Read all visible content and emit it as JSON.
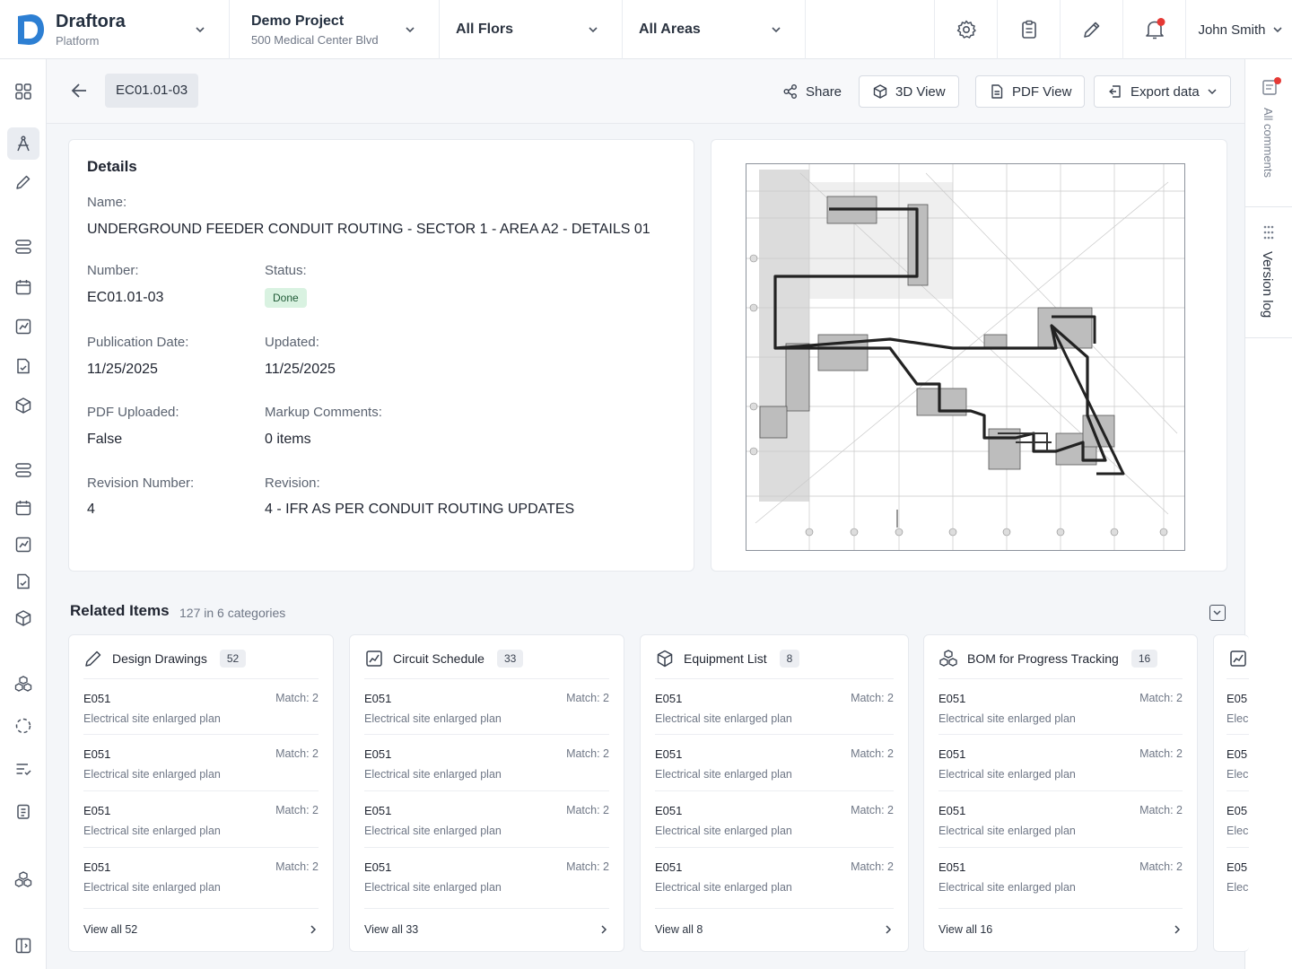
{
  "brand": {
    "name": "Draftora",
    "sub": "Platform"
  },
  "project": {
    "name": "Demo Project",
    "address": "500 Medical Center Blvd"
  },
  "filters": {
    "floors": "All Flors",
    "areas": "All Areas"
  },
  "user": {
    "name": "John Smith"
  },
  "header": {
    "code": "EC01.01-03",
    "share": "Share",
    "view3d": "3D View",
    "pdf": "PDF View",
    "export": "Export data"
  },
  "side_right": {
    "comments": "All comments",
    "version": "Version log"
  },
  "details": {
    "title": "Details",
    "name_label": "Name:",
    "name": "UNDERGROUND FEEDER CONDUIT ROUTING - SECTOR 1 - AREA A2 - DETAILS 01",
    "number_label": "Number:",
    "number": "EC01.01-03",
    "status_label": "Status:",
    "status": "Done",
    "pub_label": "Publication Date:",
    "pub": "11/25/2025",
    "upd_label": "Updated:",
    "upd": "11/25/2025",
    "pdf_label": "PDF Uploaded:",
    "pdf": "False",
    "markup_label": "Markup Comments:",
    "markup": "0 items",
    "revnum_label": "Revision Number:",
    "revnum": "4",
    "rev_label": "Revision:",
    "rev": "4 - IFR AS PER CONDUIT ROUTING UPDATES"
  },
  "related": {
    "title": "Related Items",
    "subtitle": "127 in 6 categories",
    "cards": [
      {
        "title": "Design Drawings",
        "count": "52",
        "view": "View all 52"
      },
      {
        "title": "Circuit Schedule",
        "count": "33",
        "view": "View all 33"
      },
      {
        "title": "Equipment List",
        "count": "8",
        "view": "View all 8"
      },
      {
        "title": "BOM for Progress Tracking",
        "count": "16",
        "view": "View all 16"
      }
    ],
    "row": {
      "code": "E051",
      "desc": "Electrical site enlarged plan",
      "match": "Match: 2"
    },
    "partial": {
      "code": "E05",
      "desc": "Elec"
    }
  }
}
